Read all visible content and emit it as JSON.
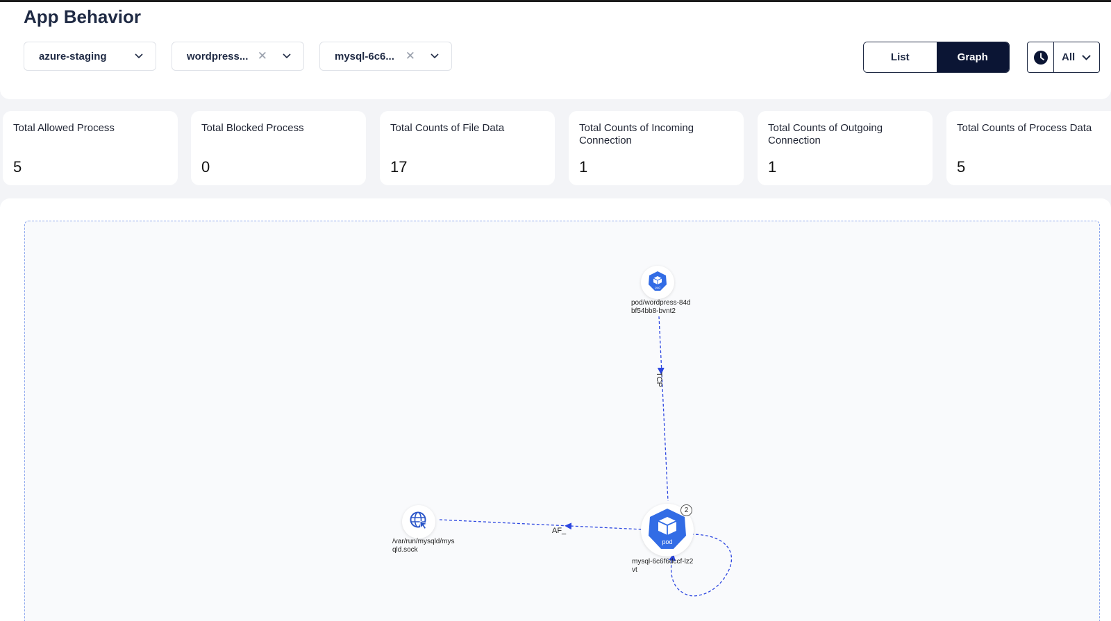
{
  "page_title": "App Behavior",
  "filters": {
    "cluster": "azure-staging",
    "workload": "wordpress...",
    "pod": "mysql-6c6..."
  },
  "view_toggle": {
    "list_label": "List",
    "graph_label": "Graph",
    "active": "Graph"
  },
  "time_filter": {
    "label": "All"
  },
  "stats": [
    {
      "title": "Total Allowed Process",
      "value": "5"
    },
    {
      "title": "Total Blocked Process",
      "value": "0"
    },
    {
      "title": "Total Counts of File Data",
      "value": "17"
    },
    {
      "title": "Total Counts of Incoming Connection",
      "value": "1"
    },
    {
      "title": "Total Counts of Outgoing Connection",
      "value": "1"
    },
    {
      "title": "Total Counts of Process Data",
      "value": "5"
    }
  ],
  "graph": {
    "nodes": {
      "wordpress": {
        "label": "pod/wordpress-84d\nbf54bb8-bvnt2",
        "badge": "pod",
        "icon": "kubernetes-pod-icon"
      },
      "mysql": {
        "label": "mysql-6c6f6dccf-lz2\nvt",
        "badge": "pod",
        "count": "2",
        "icon": "kubernetes-pod-icon"
      },
      "socket": {
        "label": "/var/run/mysqld/mys\nqld.sock",
        "icon": "globe-cursor-icon"
      }
    },
    "edges": {
      "tcp_label": "TCP",
      "af_label": "AF_"
    }
  },
  "colors": {
    "accent": "#0b1534",
    "node_blue": "#326ce5",
    "edge": "#2b45e0"
  }
}
